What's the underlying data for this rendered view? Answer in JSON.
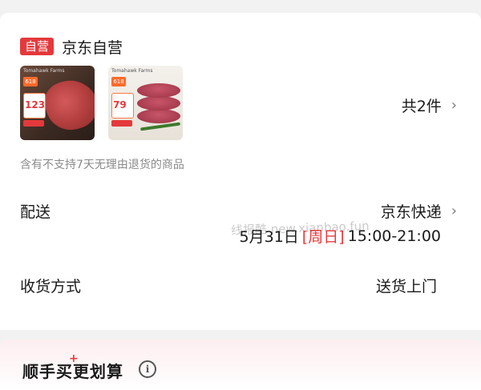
{
  "shop": {
    "badge": "自营",
    "name": "京东自营"
  },
  "items": {
    "count_label": "共2件",
    "products": [
      {
        "brand": "Tomahawk Farms",
        "badge": "618",
        "price": "123"
      },
      {
        "brand": "Tomahawk Farms",
        "badge": "618",
        "price": "79"
      }
    ]
  },
  "note": "含有不支持7天无理由退货的商品",
  "delivery": {
    "label": "配送",
    "method": "京东快递",
    "date": "5月31日",
    "day": "[周日]",
    "time": "15:00-21:00"
  },
  "receive": {
    "label": "收货方式",
    "value": "送货上门"
  },
  "watermark": "线报酷 new.xianbao.fun",
  "promo": {
    "title": "顺手买更划算",
    "plus": "+"
  },
  "icons": {
    "chevron": "›",
    "info": "i"
  },
  "colors": {
    "accent": "#e4393c",
    "muted": "#8a8a8a"
  }
}
